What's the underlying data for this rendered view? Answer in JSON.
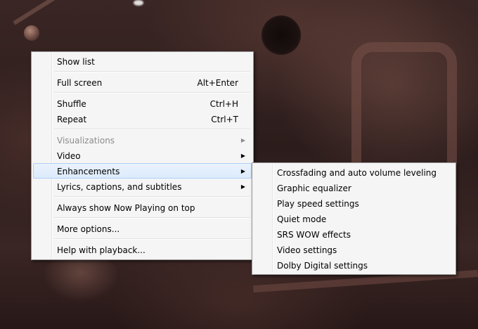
{
  "main_menu": {
    "groups": [
      [
        {
          "label": "Show list"
        }
      ],
      [
        {
          "label": "Full screen",
          "shortcut": "Alt+Enter"
        }
      ],
      [
        {
          "label": "Shuffle",
          "shortcut": "Ctrl+H"
        },
        {
          "label": "Repeat",
          "shortcut": "Ctrl+T"
        }
      ],
      [
        {
          "label": "Visualizations",
          "submenu": true,
          "disabled": true
        },
        {
          "label": "Video",
          "submenu": true
        },
        {
          "label": "Enhancements",
          "submenu": true,
          "highlighted": true
        },
        {
          "label": "Lyrics, captions, and subtitles",
          "submenu": true
        }
      ],
      [
        {
          "label": "Always show Now Playing on top"
        }
      ],
      [
        {
          "label": "More options..."
        }
      ],
      [
        {
          "label": "Help with playback..."
        }
      ]
    ]
  },
  "enhancements_submenu": {
    "items": [
      {
        "label": "Crossfading and auto volume leveling"
      },
      {
        "label": "Graphic equalizer"
      },
      {
        "label": "Play speed settings"
      },
      {
        "label": "Quiet mode"
      },
      {
        "label": "SRS WOW effects"
      },
      {
        "label": "Video settings"
      },
      {
        "label": "Dolby Digital settings"
      }
    ]
  },
  "icons": {
    "submenu_arrow": "chevron-right-icon"
  },
  "colors": {
    "menu_background": "#f5f5f5",
    "menu_border": "#979797",
    "highlight_background": "#dcebfc",
    "highlight_border": "#aecff7",
    "disabled_text": "#8c8c8c"
  }
}
